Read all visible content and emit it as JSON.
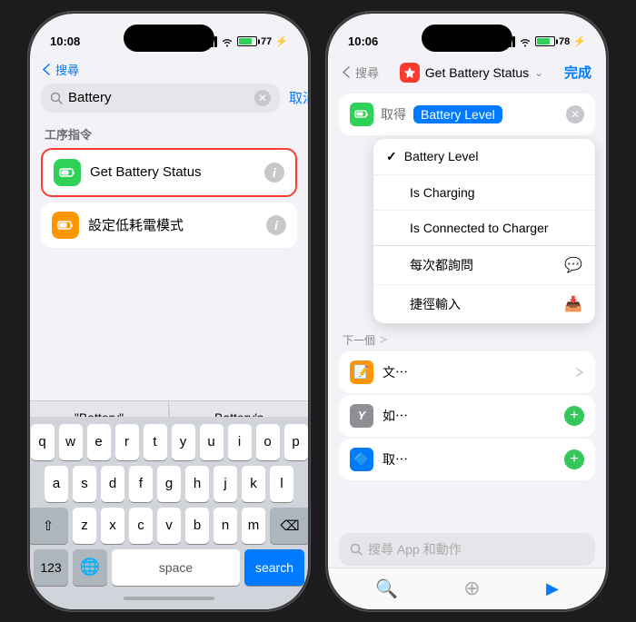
{
  "left_phone": {
    "status_bar": {
      "time": "10:08",
      "battery_pct": "77",
      "charging": true
    },
    "back_label": "搜尋",
    "search_value": "Battery",
    "cancel_label": "取消",
    "section_label": "工序指令",
    "shortcuts": [
      {
        "name": "Get Battery Status",
        "icon": "🔋",
        "icon_bg": "#30d158",
        "highlighted": true
      },
      {
        "name": "設定低耗電模式",
        "icon": "🔋",
        "icon_bg": "#ff9500",
        "highlighted": false
      }
    ],
    "suggestions": [
      "\"Battery\"",
      "Battery's"
    ],
    "keyboard": {
      "rows": [
        [
          "q",
          "w",
          "e",
          "r",
          "t",
          "y",
          "u",
          "i",
          "o",
          "p"
        ],
        [
          "a",
          "s",
          "d",
          "f",
          "g",
          "h",
          "j",
          "k",
          "l"
        ],
        [
          "z",
          "x",
          "c",
          "v",
          "b",
          "n",
          "m"
        ]
      ],
      "num_label": "123",
      "space_label": "space",
      "search_label": "search",
      "shift_symbol": "⇧",
      "delete_symbol": "⌫"
    }
  },
  "right_phone": {
    "status_bar": {
      "time": "10:06",
      "battery_pct": "78",
      "charging": true
    },
    "back_label": "搜尋",
    "app_icon": "🔒",
    "app_icon_bg": "#ff3b30",
    "app_title": "Get Battery Status",
    "done_label": "完成",
    "action_label": "取得",
    "action_value": "Battery Level",
    "dropdown_items": [
      {
        "label": "Battery Level",
        "checked": true
      },
      {
        "label": "Is Charging",
        "checked": false
      },
      {
        "label": "Is Connected to Charger",
        "checked": false,
        "divider": true
      },
      {
        "label": "每次都詢問",
        "checked": false,
        "icon": "💬"
      },
      {
        "label": "捷徑輸入",
        "checked": false,
        "icon": "📥"
      }
    ],
    "next_label": "下一個",
    "action_items": [
      {
        "label": "文⋯",
        "icon": "📝",
        "icon_bg": "#ff9500",
        "has_expand": true,
        "has_plus": false
      },
      {
        "label": "如⋯",
        "icon": "Y",
        "icon_bg": "#8e8e93",
        "has_expand": false,
        "has_plus": true
      },
      {
        "label": "取⋯",
        "icon": "🔷",
        "icon_bg": "#007aff",
        "has_expand": false,
        "has_plus": true
      }
    ],
    "bottom_search_placeholder": "搜尋 App 和動作",
    "nav_icons": [
      "🔍",
      "⊕",
      "▶"
    ]
  }
}
